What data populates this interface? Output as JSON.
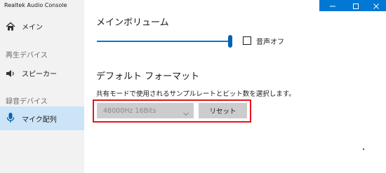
{
  "window": {
    "title": "Realtek Audio Console",
    "controls": {
      "minimize": "minimize-icon",
      "maximize": "maximize-icon",
      "close": "close-icon"
    },
    "accent_color": "#0078d4"
  },
  "sidebar": {
    "home": {
      "label": "メイン",
      "icon": "home-icon"
    },
    "playback_section": "再生デバイス",
    "speaker": {
      "label": "スピーカー",
      "icon": "speaker-icon"
    },
    "recording_section": "録音デバイス",
    "mic_array": {
      "label": "マイク配列",
      "icon": "microphone-icon",
      "selected": true
    },
    "selected_color": "#cce4f7"
  },
  "main": {
    "volume": {
      "heading": "メインボリューム",
      "level_percent": 100,
      "mute_label": "音声オフ",
      "muted": false
    },
    "format": {
      "heading": "デフォルト フォーマット",
      "description": "共有モードで使用されるサンプルレートとビット数を選択します。",
      "selected_value": "48000Hz 16Bits",
      "reset_label": "リセット",
      "highlight_color": "#e3161b"
    }
  }
}
